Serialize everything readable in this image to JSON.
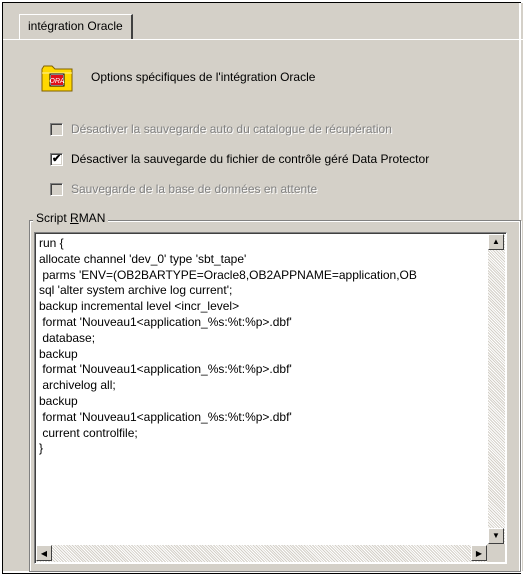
{
  "tab": {
    "label": "intégration Oracle"
  },
  "header": {
    "title": "Options spécifiques de l'intégration Oracle",
    "icon": "oracle-folder-icon"
  },
  "options": [
    {
      "label": "Désactiver la sauvegarde auto du catalogue de récupération",
      "checked": false,
      "enabled": false
    },
    {
      "label": "Désactiver la sauvegarde du fichier de contrôle géré Data Protector",
      "checked": true,
      "enabled": true
    },
    {
      "label": "Sauvegarde de la base de données en attente",
      "checked": false,
      "enabled": false
    }
  ],
  "rman": {
    "group_label_pre": "Script ",
    "group_label_mnemonic": "R",
    "group_label_post": "MAN",
    "script": "run {\nallocate channel 'dev_0' type 'sbt_tape'\n parms 'ENV=(OB2BARTYPE=Oracle8,OB2APPNAME=application,OB\nsql 'alter system archive log current';\nbackup incremental level <incr_level>\n format 'Nouveau1<application_%s:%t:%p>.dbf'\n database;\nbackup\n format 'Nouveau1<application_%s:%t:%p>.dbf'\n archivelog all;\nbackup\n format 'Nouveau1<application_%s:%t:%p>.dbf'\n current controlfile;\n}"
  },
  "colors": {
    "dialog_bg": "#d4d0c8",
    "icon_yellow": "#ffd800",
    "icon_red": "#e0101a"
  }
}
